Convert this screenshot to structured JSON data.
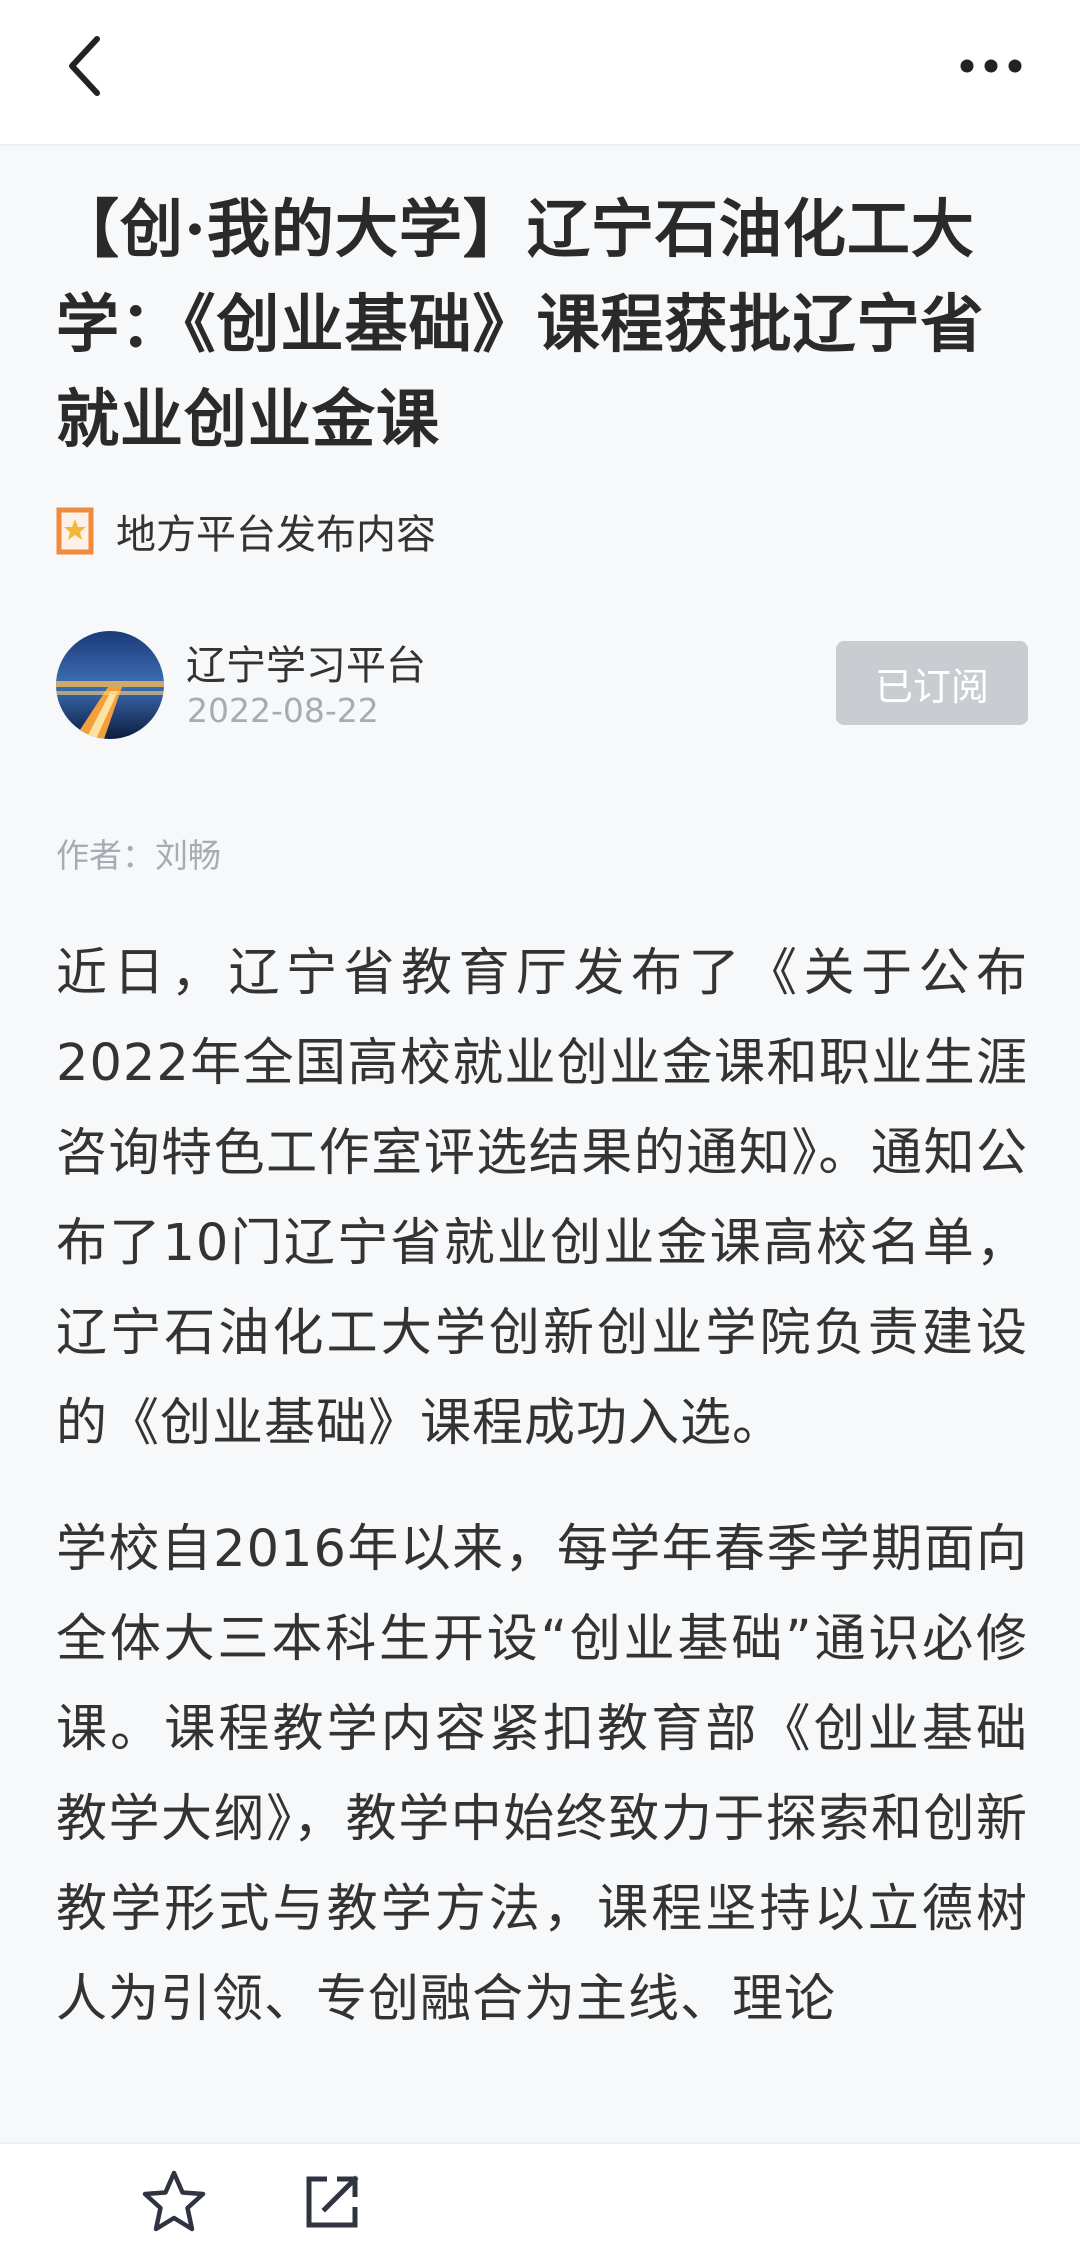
{
  "topbar": {
    "back_icon": "chevron-left-icon",
    "more_icon": "more-horizontal-icon"
  },
  "article": {
    "title": "【创·我的大学】辽宁石油化工大学：《创业基础》课程获批辽宁省就业创业金课",
    "source_icon": "bookmark-star-icon",
    "source_label": "地方平台发布内容",
    "channel_name": "辽宁学习平台",
    "publish_date": "2022-08-22",
    "subscribe_label": "已订阅",
    "byline": "作者：刘畅",
    "paragraphs": [
      "近日，辽宁省教育厅发布了《关于公布2022年全国高校就业创业金课和职业生涯咨询特色工作室评选结果的通知》。通知公布了10门辽宁省就业创业金课高校名单，辽宁石油化工大学创新创业学院负责建设的《创业基础》课程成功入选。",
      "学校自2016年以来，每学年春季学期面向全体大三本科生开设“创业基础”通识必修课。课程教学内容紧扣教育部《创业基础教学大纲》，教学中始终致力于探索和创新教学形式与教学方法，课程坚持以立德树人为引领、专创融合为主线、理论"
    ]
  },
  "bottombar": {
    "favorite_icon": "star-outline-icon",
    "share_icon": "share-external-icon"
  },
  "colors": {
    "page_background": "#f7f8fa",
    "title_text": "#2a2a2a",
    "body_text": "#333333",
    "muted_text": "#a7abb3",
    "subscribed_button": "#c9ccd1",
    "source_icon_accent": "#f08a3c"
  }
}
